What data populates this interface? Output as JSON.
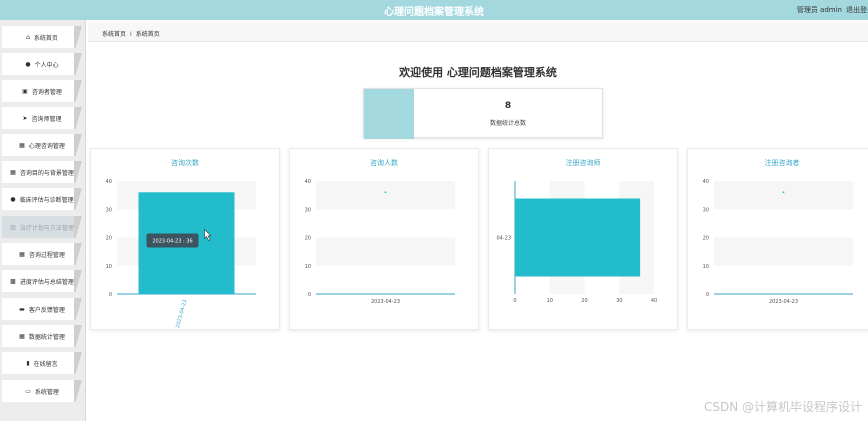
{
  "header": {
    "title": "心理问题档案管理系统",
    "user_text": "管理员 admin",
    "logout_label": "退出登录"
  },
  "sidebar": {
    "items": [
      {
        "label": "系统首页",
        "icon": "home-icon",
        "glyph": "⌂"
      },
      {
        "label": "个人中心",
        "icon": "user-icon",
        "glyph": "●"
      },
      {
        "label": "咨询者管理",
        "icon": "edit-icon",
        "glyph": "▣"
      },
      {
        "label": "咨询师管理",
        "icon": "send-icon",
        "glyph": "➤"
      },
      {
        "label": "心理咨询管理",
        "icon": "grid-icon",
        "glyph": "▦"
      },
      {
        "label": "咨询目的与背景管理",
        "icon": "grid-icon",
        "glyph": "▦"
      },
      {
        "label": "临床评估与诊断管理",
        "icon": "user-icon",
        "glyph": "●"
      },
      {
        "label": "治疗计划与方法管理",
        "icon": "bank-icon",
        "glyph": "▥"
      },
      {
        "label": "咨询过程管理",
        "icon": "grid-icon",
        "glyph": "▦"
      },
      {
        "label": "进度评估与总结管理",
        "icon": "image-icon",
        "glyph": "▩"
      },
      {
        "label": "客户反馈管理",
        "icon": "trash-icon",
        "glyph": "▬"
      },
      {
        "label": "数据统计管理",
        "icon": "grid-icon",
        "glyph": "▦"
      },
      {
        "label": "在线留言",
        "icon": "bar-chart-icon",
        "glyph": "▮"
      },
      {
        "label": "系统管理",
        "icon": "monitor-icon",
        "glyph": "▭"
      }
    ],
    "active_index": 7
  },
  "breadcrumb": {
    "home": "系统首页",
    "separator": "I",
    "current": "系统首页"
  },
  "welcome": "欢迎使用 心理问题档案管理系统",
  "summary": {
    "value": "8",
    "label": "数据统计总数"
  },
  "colors": {
    "accent": "#a4d8df",
    "bar": "#22bccd",
    "title": "#3aa6c8",
    "axis": "#3aa6c8"
  },
  "chart_data": [
    {
      "type": "bar",
      "title": "咨询次数",
      "categories": [
        "2023-04-23"
      ],
      "values": [
        36
      ],
      "ylim": [
        0,
        40
      ],
      "ticks": [
        "0",
        "10",
        "20",
        "30",
        "40"
      ],
      "tooltip": "2023-04-23 : 36",
      "orientation": "vertical"
    },
    {
      "type": "scatter",
      "title": "咨询人数",
      "categories": [
        "2023-04-23"
      ],
      "ylim": [
        0,
        40
      ],
      "ticks": [
        "0",
        "10",
        "20",
        "30",
        "40"
      ]
    },
    {
      "type": "bar",
      "title": "注册咨询师",
      "categories": [
        "04-23"
      ],
      "values": [
        36
      ],
      "xlim": [
        0,
        40
      ],
      "ticks": [
        "0",
        "10",
        "20",
        "30",
        "40"
      ],
      "orientation": "horizontal"
    },
    {
      "type": "scatter",
      "title": "注册咨询者",
      "categories": [
        "2023-04-23"
      ],
      "ylim": [
        0,
        40
      ],
      "ticks": [
        "0",
        "10",
        "20",
        "30",
        "40"
      ]
    }
  ],
  "watermark": "CSDN @计算机毕设程序设计"
}
